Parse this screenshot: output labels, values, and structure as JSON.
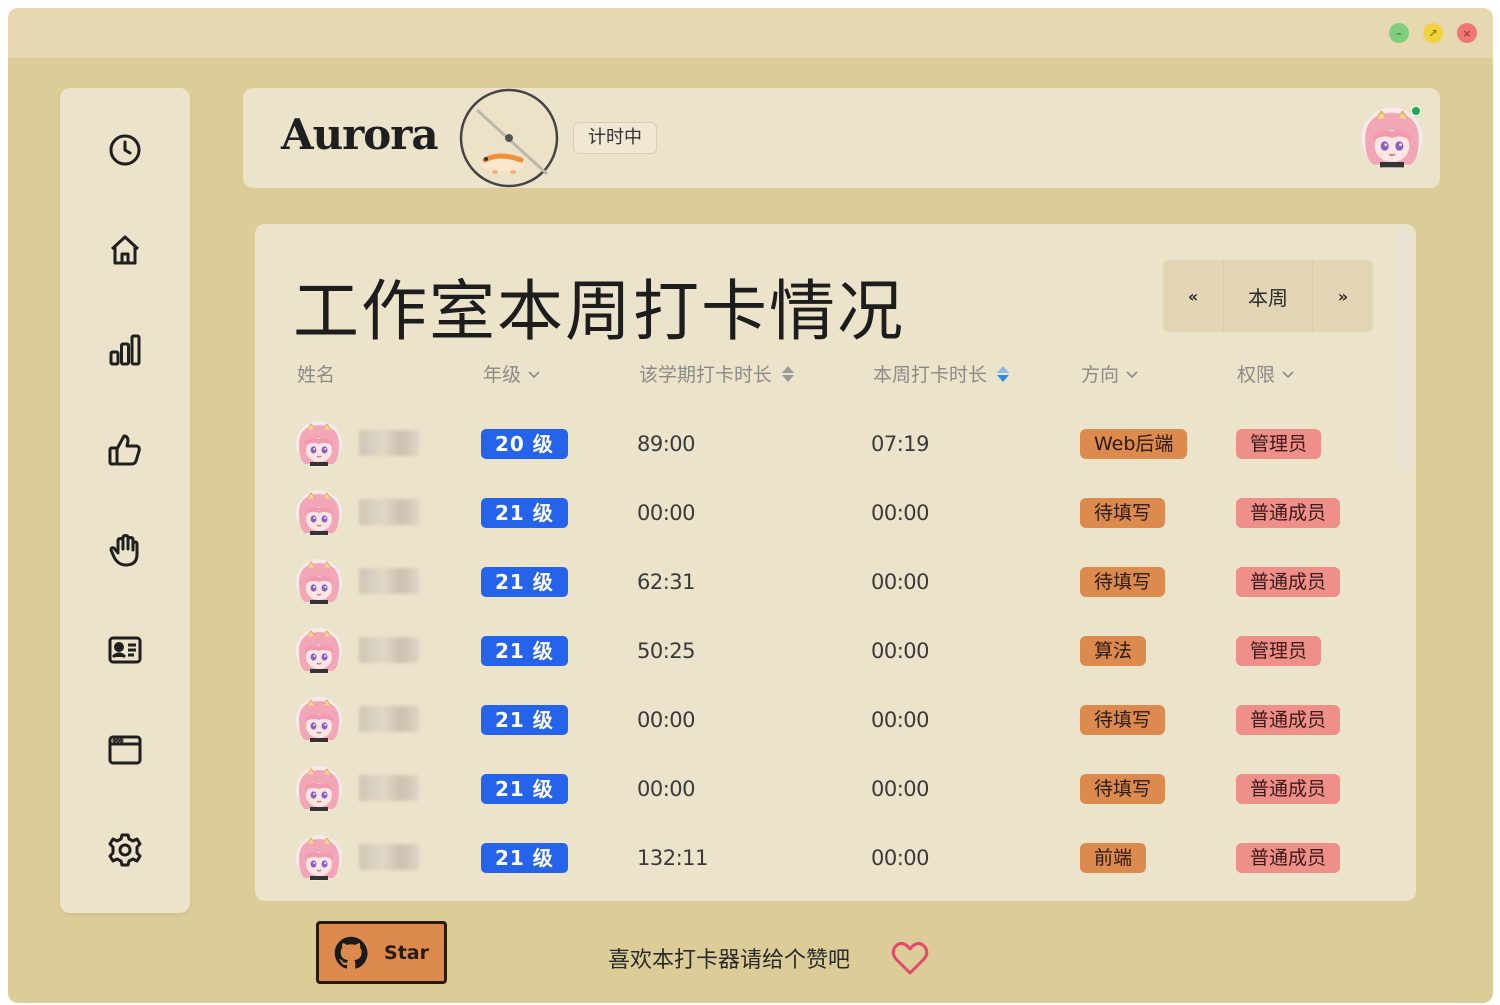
{
  "window_controls": {
    "minimize": "–",
    "maximize": "↗",
    "close": "×"
  },
  "header": {
    "brand": "Aurora",
    "timer_status": "计时中"
  },
  "panel": {
    "title": "工作室本周打卡情况",
    "week_nav": {
      "prev": "«",
      "label": "本周",
      "next": "»"
    },
    "columns": {
      "name": "姓名",
      "grade": "年级",
      "semester_time": "该学期打卡时长",
      "week_time": "本周打卡时长",
      "direction": "方向",
      "role": "权限"
    },
    "rows": [
      {
        "grade": "20 级",
        "semester_time": "89:00",
        "week_time": "07:19",
        "direction": "Web后端",
        "role": "管理员"
      },
      {
        "grade": "21 级",
        "semester_time": "00:00",
        "week_time": "00:00",
        "direction": "待填写",
        "role": "普通成员"
      },
      {
        "grade": "21 级",
        "semester_time": "62:31",
        "week_time": "00:00",
        "direction": "待填写",
        "role": "普通成员"
      },
      {
        "grade": "21 级",
        "semester_time": "50:25",
        "week_time": "00:00",
        "direction": "算法",
        "role": "管理员"
      },
      {
        "grade": "21 级",
        "semester_time": "00:00",
        "week_time": "00:00",
        "direction": "待填写",
        "role": "普通成员"
      },
      {
        "grade": "21 级",
        "semester_time": "00:00",
        "week_time": "00:00",
        "direction": "待填写",
        "role": "普通成员"
      },
      {
        "grade": "21 级",
        "semester_time": "132:11",
        "week_time": "00:00",
        "direction": "前端",
        "role": "普通成员"
      }
    ]
  },
  "footer": {
    "star_label": "Star",
    "message": "喜欢本打卡器请给个赞吧"
  },
  "sidebar": {
    "items": [
      {
        "icon": "clock-icon"
      },
      {
        "icon": "home-icon"
      },
      {
        "icon": "bar-chart-icon"
      },
      {
        "icon": "thumbs-up-icon"
      },
      {
        "icon": "hand-icon"
      },
      {
        "icon": "id-card-icon"
      },
      {
        "icon": "browser-window-icon"
      },
      {
        "icon": "gear-icon"
      }
    ]
  },
  "colors": {
    "background": "#dccc98",
    "card": "#ece3cb",
    "grade_badge": "#2563eb",
    "direction_badge": "#dd8a4f",
    "role_badge": "#ef8f8a",
    "online": "#1ea65a"
  }
}
